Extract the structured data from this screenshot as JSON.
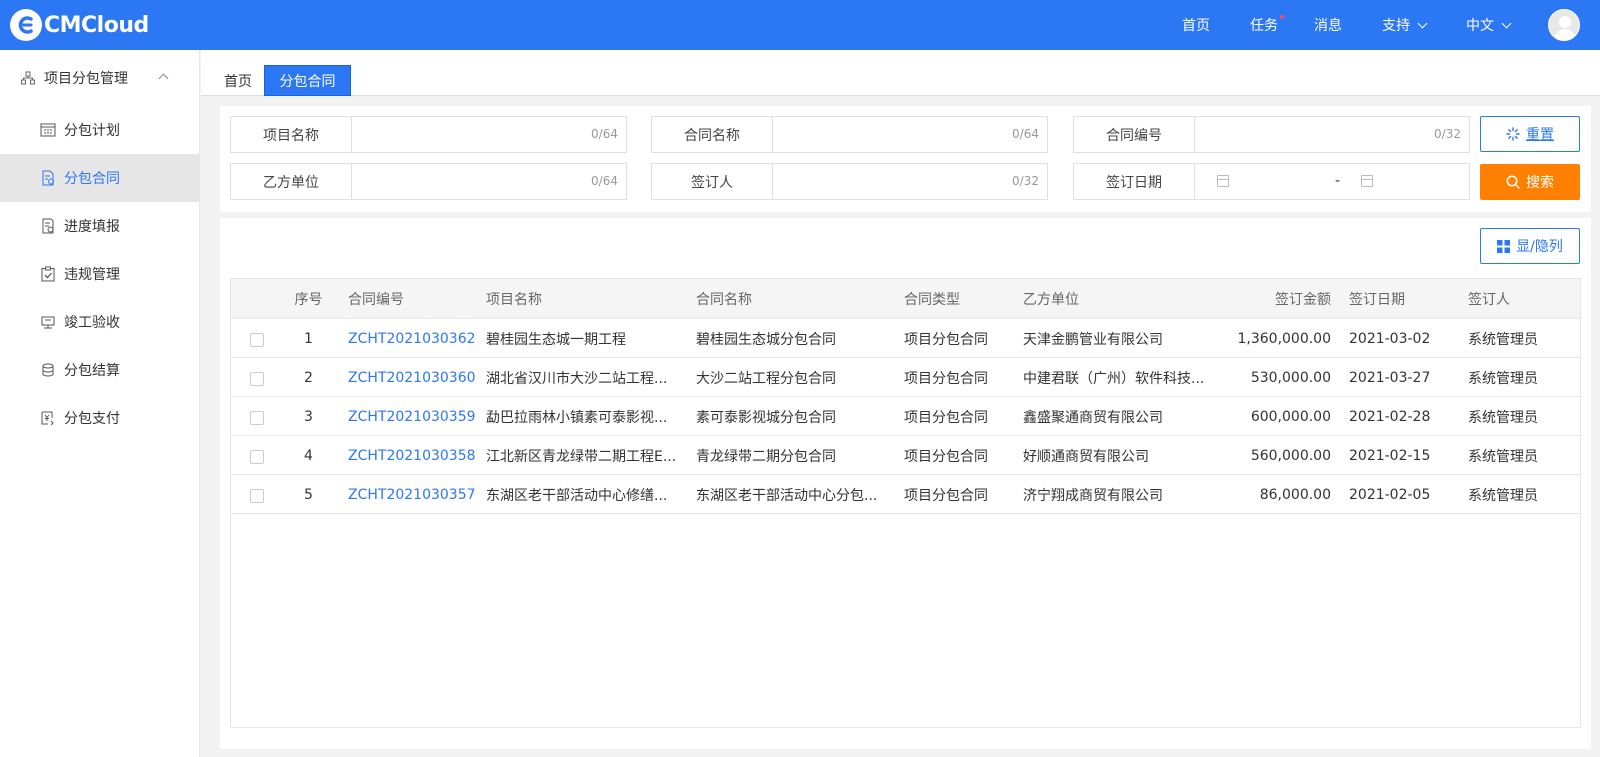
{
  "app": {
    "logo_text": "CMCloud"
  },
  "topnav": {
    "items": [
      "首页",
      "任务",
      "消息"
    ],
    "support": "支持",
    "language": "中文"
  },
  "sidebar": {
    "group_label": "项目分包管理",
    "items": [
      {
        "label": "分包计划",
        "icon": "calendar-grid-icon"
      },
      {
        "label": "分包合同",
        "icon": "contract-icon"
      },
      {
        "label": "进度填报",
        "icon": "progress-report-icon"
      },
      {
        "label": "违规管理",
        "icon": "clipboard-check-icon"
      },
      {
        "label": "竣工验收",
        "icon": "acceptance-icon"
      },
      {
        "label": "分包结算",
        "icon": "coins-icon"
      },
      {
        "label": "分包支付",
        "icon": "payment-icon"
      }
    ]
  },
  "tabs": {
    "home": "首页",
    "active": "分包合同"
  },
  "filters": {
    "project_name": {
      "label": "项目名称",
      "counter": "0/64"
    },
    "contract_name": {
      "label": "合同名称",
      "counter": "0/64"
    },
    "contract_no": {
      "label": "合同编号",
      "counter": "0/32"
    },
    "party_b": {
      "label": "乙方单位",
      "counter": "0/64"
    },
    "signer": {
      "label": "签订人",
      "counter": "0/32"
    },
    "sign_date": {
      "label": "签订日期",
      "separator": "-"
    },
    "reset_label": "重置",
    "search_label": "搜索"
  },
  "table": {
    "toggle_columns_label": "显/隐列",
    "headers": {
      "index": "序号",
      "contract_no": "合同编号",
      "project": "项目名称",
      "contract_name": "合同名称",
      "type": "合同类型",
      "party_b": "乙方单位",
      "amount": "签订金额",
      "date": "签订日期",
      "signer": "签订人"
    },
    "rows": [
      {
        "index": "1",
        "contract_no": "ZCHT2021030362",
        "project": "碧桂园生态城一期工程",
        "contract_name": "碧桂园生态城分包合同",
        "type": "项目分包合同",
        "party_b": "天津金鹏管业有限公司",
        "amount": "1,360,000.00",
        "date": "2021-03-02",
        "signer": "系统管理员"
      },
      {
        "index": "2",
        "contract_no": "ZCHT2021030360",
        "project": "湖北省汉川市大沙二站工程...",
        "contract_name": "大沙二站工程分包合同",
        "type": "项目分包合同",
        "party_b": "中建君联（广州）软件科技...",
        "amount": "530,000.00",
        "date": "2021-03-27",
        "signer": "系统管理员"
      },
      {
        "index": "3",
        "contract_no": "ZCHT2021030359",
        "project": "勐巴拉雨林小镇素可泰影视...",
        "contract_name": "素可泰影视城分包合同",
        "type": "项目分包合同",
        "party_b": "鑫盛聚通商贸有限公司",
        "amount": "600,000.00",
        "date": "2021-02-28",
        "signer": "系统管理员"
      },
      {
        "index": "4",
        "contract_no": "ZCHT2021030358",
        "project": "江北新区青龙绿带二期工程E...",
        "contract_name": "青龙绿带二期分包合同",
        "type": "项目分包合同",
        "party_b": "好顺通商贸有限公司",
        "amount": "560,000.00",
        "date": "2021-02-15",
        "signer": "系统管理员"
      },
      {
        "index": "5",
        "contract_no": "ZCHT2021030357",
        "project": "东湖区老干部活动中心修缮...",
        "contract_name": "东湖区老干部活动中心分包...",
        "type": "项目分包合同",
        "party_b": "济宁翔成商贸有限公司",
        "amount": "86,000.00",
        "date": "2021-02-05",
        "signer": "系统管理员"
      }
    ]
  },
  "colors": {
    "primary": "#2c77f4",
    "accent": "#ff8000"
  }
}
